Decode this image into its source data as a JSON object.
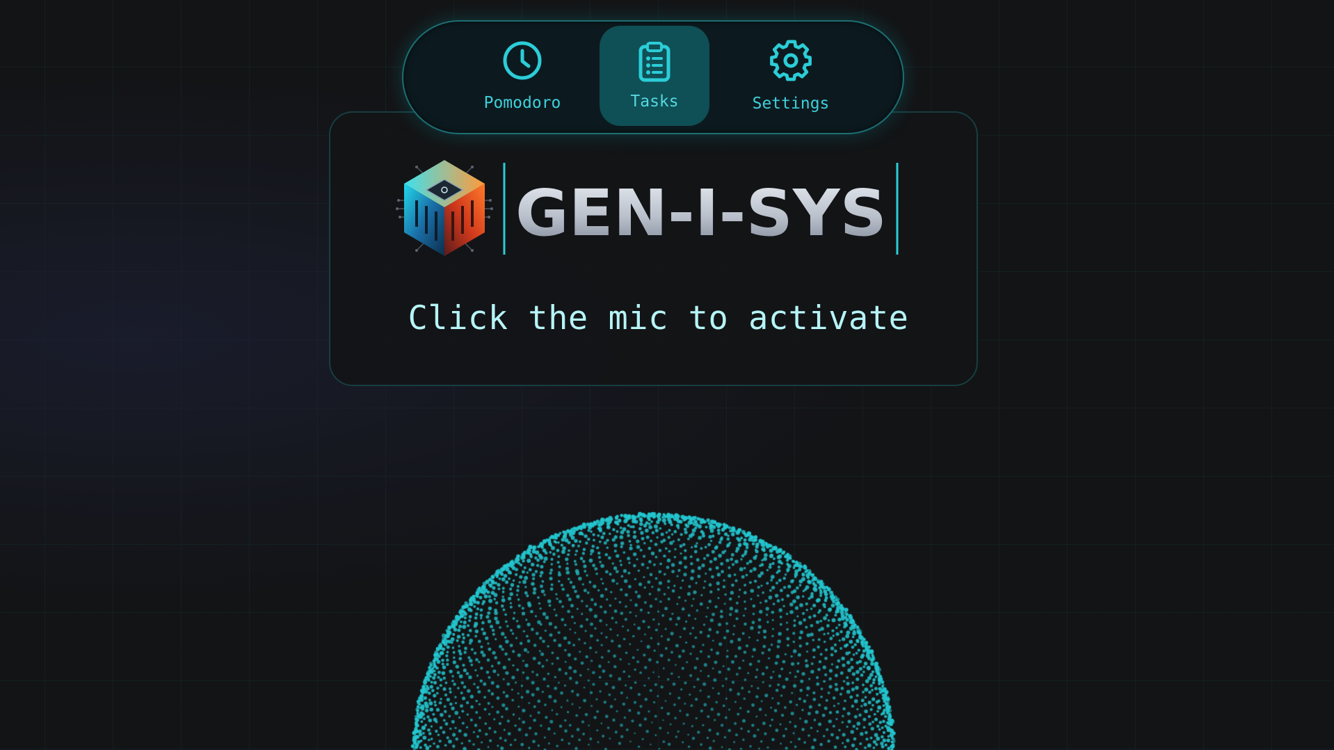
{
  "nav": {
    "items": [
      {
        "id": "pomodoro",
        "label": "Pomodoro",
        "icon": "clock-icon",
        "active": false
      },
      {
        "id": "tasks",
        "label": "Tasks",
        "icon": "clipboard-list-icon",
        "active": true
      },
      {
        "id": "settings",
        "label": "Settings",
        "icon": "gear-icon",
        "active": false
      }
    ]
  },
  "brand": {
    "name": "GEN-I-SYS",
    "logo_icon": "circuit-cube-logo"
  },
  "main": {
    "prompt": "Click the mic to activate"
  },
  "visualizer": {
    "type": "particle-sphere",
    "state": "idle"
  },
  "colors": {
    "accent": "#2bcdd7",
    "background": "#131416",
    "active_tab": "#0f4f56",
    "particles": "#23c6cf"
  }
}
